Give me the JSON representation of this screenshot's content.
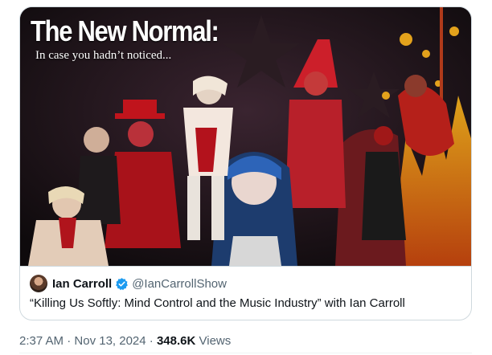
{
  "image": {
    "headline": "The New Normal:",
    "subhead": "In case you hadn’t noticed..."
  },
  "quote": {
    "name": "Ian Carroll",
    "handle": "@IanCarrollShow",
    "text": "“Killing Us Softly: Mind Control and the Music Industry” with Ian Carroll",
    "verified_color": "#1d9bf0"
  },
  "meta": {
    "time": "2:37 AM",
    "sep1": " · ",
    "date": "Nov 13, 2024",
    "sep2": " · ",
    "views_count": "348.6K",
    "views_label": " Views"
  }
}
